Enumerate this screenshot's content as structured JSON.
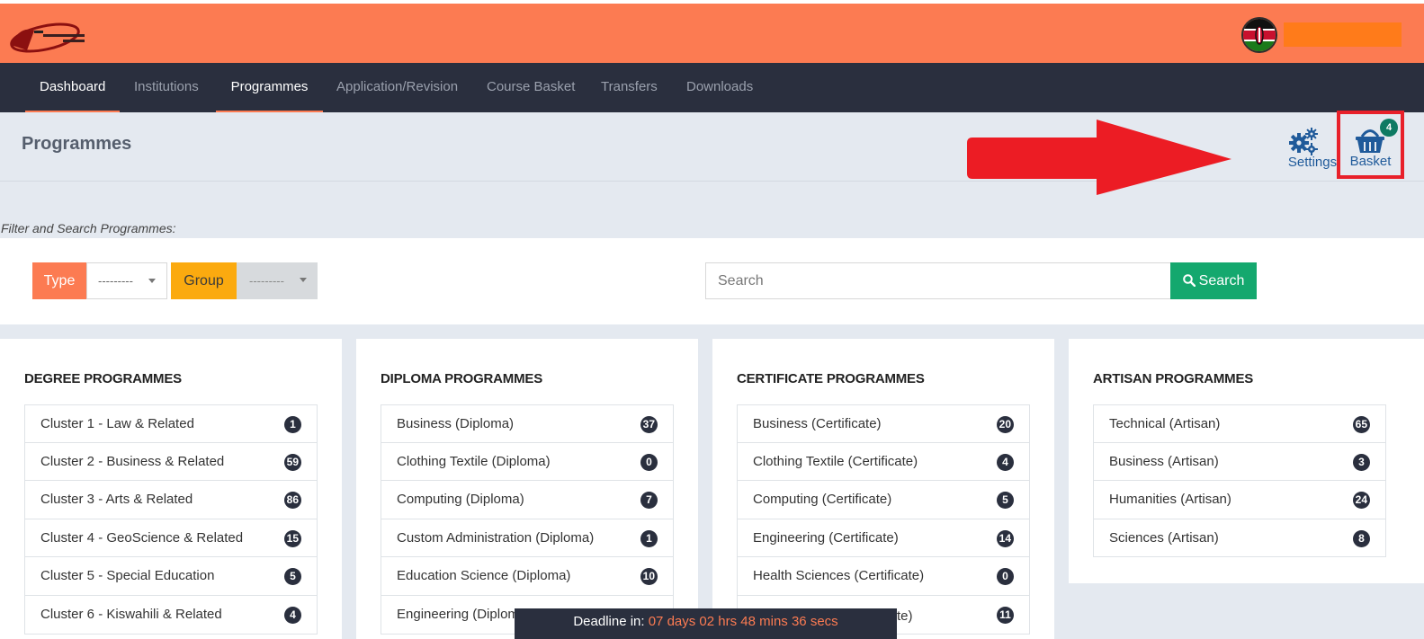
{
  "nav": {
    "items": [
      {
        "label": "Dashboard"
      },
      {
        "label": "Institutions"
      },
      {
        "label": "Programmes"
      },
      {
        "label": "Application/Revision"
      },
      {
        "label": "Course Basket"
      },
      {
        "label": "Transfers"
      },
      {
        "label": "Downloads"
      }
    ]
  },
  "header": {
    "title": "Programmes",
    "settings_label": "Settings",
    "basket_label": "Basket",
    "basket_count": "4"
  },
  "filter": {
    "caption": "Filter and Search Programmes:",
    "type_label": "Type",
    "type_value": "---------",
    "group_label": "Group",
    "group_value": "---------",
    "search_placeholder": "Search",
    "search_button": "Search"
  },
  "cards": [
    {
      "title": "DEGREE PROGRAMMES",
      "items": [
        {
          "label": "Cluster 1 - Law & Related",
          "count": "1"
        },
        {
          "label": "Cluster 2 - Business & Related",
          "count": "59"
        },
        {
          "label": "Cluster 3 - Arts & Related",
          "count": "86"
        },
        {
          "label": "Cluster 4 - GeoScience & Related",
          "count": "15"
        },
        {
          "label": "Cluster 5 - Special Education",
          "count": "5"
        },
        {
          "label": "Cluster 6 - Kiswahili & Related",
          "count": "4"
        }
      ]
    },
    {
      "title": "DIPLOMA PROGRAMMES",
      "items": [
        {
          "label": "Business (Diploma)",
          "count": "37"
        },
        {
          "label": "Clothing Textile (Diploma)",
          "count": "0"
        },
        {
          "label": "Computing (Diploma)",
          "count": "7"
        },
        {
          "label": "Custom Administration (Diploma)",
          "count": "1"
        },
        {
          "label": "Education Science (Diploma)",
          "count": "10"
        },
        {
          "label": "Engineering (Diplom",
          "count": ""
        }
      ]
    },
    {
      "title": "CERTIFICATE PROGRAMMES",
      "items": [
        {
          "label": "Business (Certificate)",
          "count": "20"
        },
        {
          "label": "Clothing Textile (Certificate)",
          "count": "4"
        },
        {
          "label": "Computing (Certificate)",
          "count": "5"
        },
        {
          "label": "Engineering (Certificate)",
          "count": "14"
        },
        {
          "label": "Health Sciences (Certificate)",
          "count": "0"
        },
        {
          "label": "",
          "count": "11"
        }
      ]
    },
    {
      "title": "ARTISAN PROGRAMMES",
      "items": [
        {
          "label": "Technical (Artisan)",
          "count": "65"
        },
        {
          "label": "Business (Artisan)",
          "count": "3"
        },
        {
          "label": "Humanities (Artisan)",
          "count": "24"
        },
        {
          "label": "Sciences (Artisan)",
          "count": "8"
        }
      ]
    }
  ],
  "deadline": {
    "label": "Deadline in:",
    "time": "07 days 02 hrs 48 mins 36 secs",
    "partial_text": "te)"
  },
  "colors": {
    "accent": "#fc7b52",
    "nav_bg": "#2a2f3e",
    "search_green": "#14a86e",
    "group_yellow": "#fbaa0f",
    "basket_highlight": "#e8202a",
    "arrow_red": "#ec1c24"
  }
}
